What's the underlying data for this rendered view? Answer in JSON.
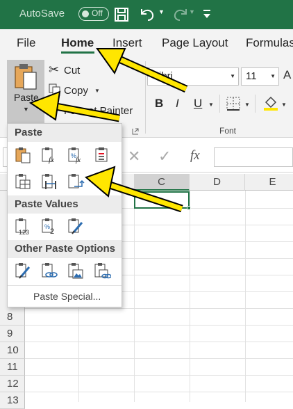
{
  "titlebar": {
    "autosave_label": "AutoSave",
    "autosave_state": "Off"
  },
  "tabs": [
    "File",
    "Home",
    "Insert",
    "Page Layout",
    "Formulas"
  ],
  "ribbon": {
    "paste": "Paste",
    "cut": "Cut",
    "copy": "Copy",
    "format_painter": "Format Painter",
    "font_name": "Calibri",
    "font_name_visible": "ibri",
    "font_size": "11",
    "bold": "B",
    "italic": "I",
    "underline": "U",
    "font_group": "Font"
  },
  "formula_bar": {
    "fx": "fx"
  },
  "grid": {
    "columns": [
      "C",
      "D",
      "E"
    ],
    "rows": [
      "8",
      "9",
      "10",
      "11",
      "12",
      "13"
    ]
  },
  "paste_menu": {
    "section_paste": "Paste",
    "section_values": "Paste Values",
    "section_other": "Other Paste Options",
    "paste_special": "Paste Special..."
  },
  "colors": {
    "excel_green": "#217346",
    "highlight_yellow": "#ffe600",
    "font_color_red": "#e81123"
  }
}
